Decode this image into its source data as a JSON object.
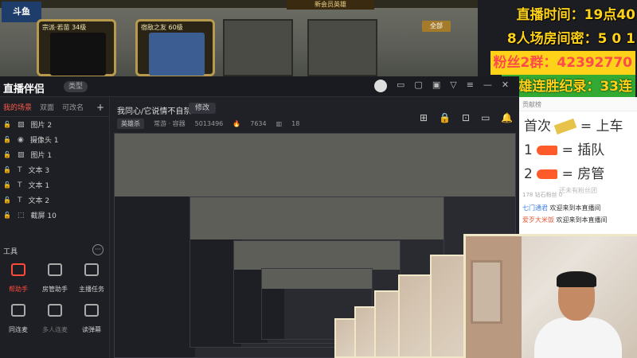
{
  "game": {
    "logo": "斗鱼",
    "new_button": "新会员英雄",
    "all_button": "全部",
    "cards": [
      {
        "name": "宗派·若苗 34级"
      },
      {
        "name": "宿敌之友 60级"
      }
    ]
  },
  "overlay": {
    "line1": "直播时间：19点40",
    "line2": "8人场房间密：5 0 1",
    "line3": "粉丝2群：42392770",
    "line4": "双雄连胜纪录：33连"
  },
  "app": {
    "brand": "直播伴侣",
    "version_badge": "类型",
    "title_icons": [
      "avatar",
      "msg-icon",
      "folder-icon",
      "screen-icon",
      "filter-icon",
      "menu-icon",
      "minimize-icon",
      "close-icon"
    ]
  },
  "sidebar": {
    "tabs": [
      "我的场景",
      "双面",
      "可改名"
    ],
    "active_tab": "我的场景",
    "add_label": "+",
    "sources": [
      {
        "icon": "image-icon",
        "label": "图片 2"
      },
      {
        "icon": "camera-icon",
        "label": "摄像头 1"
      },
      {
        "icon": "image-icon",
        "label": "图片 1"
      },
      {
        "icon": "text-icon",
        "label": "文本 3"
      },
      {
        "icon": "text-icon",
        "label": "文本 1"
      },
      {
        "icon": "text-icon",
        "label": "文本 2"
      },
      {
        "icon": "screenshot-icon",
        "label": "截屏 10"
      }
    ],
    "tools_title": "工具",
    "more_label": "···",
    "tools": [
      {
        "label": "帮助手",
        "accent": true
      },
      {
        "label": "房管助手",
        "accent": false
      },
      {
        "label": "主播任务",
        "accent": false
      },
      {
        "label": "同连麦",
        "accent": false
      },
      {
        "label": "多人连麦",
        "accent": false,
        "dim": true
      },
      {
        "label": "读弹幕",
        "accent": false
      }
    ]
  },
  "main": {
    "room_title": "我同心/它说情不自禁",
    "edit_button": "修改",
    "meta_chip": "英雄杀",
    "category": "常游 · 容器",
    "room_id": "5013496",
    "heat": "7634",
    "viewers": "18",
    "toolbar_icons": [
      "grid-icon",
      "lock-icon",
      "record-icon",
      "notify-icon",
      "bell-icon",
      "share-icon"
    ]
  },
  "panel": {
    "header": "贡献榜",
    "guide": [
      {
        "prefix": "首次",
        "item": "gold-bar",
        "text": "= 上车"
      },
      {
        "prefix": "1",
        "item": "plane",
        "text": "= 插队"
      },
      {
        "prefix": "2",
        "item": "plane",
        "text": "= 房管"
      }
    ],
    "guide_note": "还未有粉丝团",
    "stats": "178  钻石粉丝 0",
    "messages": [
      {
        "user": "七门通君",
        "text": "欢迎来到本直播间"
      },
      {
        "user": "爱歹大米饭",
        "text": "欢迎来到本直播间"
      }
    ]
  }
}
